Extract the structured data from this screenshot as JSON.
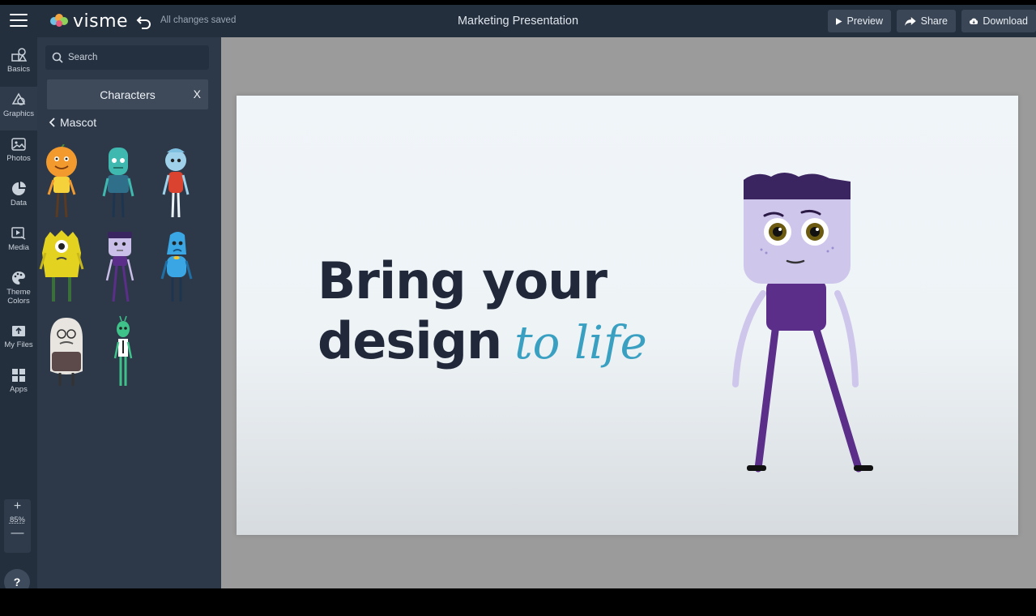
{
  "topbar": {
    "brand": "visme",
    "saved_status": "All changes saved",
    "document_title": "Marketing Presentation",
    "preview_label": "Preview",
    "share_label": "Share",
    "download_label": "Download"
  },
  "rail": {
    "items": [
      {
        "label": "Basics",
        "icon": "shapes-icon"
      },
      {
        "label": "Graphics",
        "icon": "graphics-icon"
      },
      {
        "label": "Photos",
        "icon": "photo-icon"
      },
      {
        "label": "Data",
        "icon": "pie-chart-icon"
      },
      {
        "label": "Media",
        "icon": "media-icon"
      },
      {
        "label": "Theme Colors",
        "icon": "palette-icon"
      },
      {
        "label": "My Files",
        "icon": "upload-icon"
      },
      {
        "label": "Apps",
        "icon": "apps-grid-icon"
      }
    ],
    "zoom": "85%",
    "help_label": "?"
  },
  "panel": {
    "search_placeholder": "Search",
    "category_title": "Characters",
    "close_label": "X",
    "back_label": "Mascot"
  },
  "canvas": {
    "headline_line1": "Bring your",
    "headline_line2": "design",
    "headline_script": "to life"
  },
  "colors": {
    "topbar": "#242f3e",
    "panel": "#2d3949",
    "accent_script": "#3aa0c2",
    "headline": "#20283a",
    "mascot_purple": "#c9bfe8",
    "mascot_dark": "#4a2a7a"
  }
}
